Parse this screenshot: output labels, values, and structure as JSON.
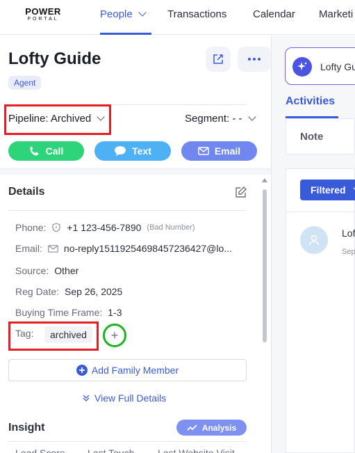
{
  "brand": {
    "line1": "POWER",
    "line2": "PORTAL"
  },
  "nav": {
    "people": "People",
    "transactions": "Transactions",
    "calendar": "Calendar",
    "marketing": "Marketi"
  },
  "contact": {
    "name": "Lofty Guide",
    "badge": "Agent"
  },
  "pipeline": {
    "label": "Pipeline:",
    "value": "Archived"
  },
  "segment": {
    "label": "Segment:",
    "value": "- -"
  },
  "actions": {
    "call": "Call",
    "text": "Text",
    "email": "Email"
  },
  "details": {
    "title": "Details",
    "phone_label": "Phone:",
    "phone_value": "+1 123-456-7890",
    "phone_note": "(Bad Number)",
    "email_label": "Email:",
    "email_value": "no-reply15119254698457236427@lo...",
    "source_label": "Source:",
    "source_value": "Other",
    "regdate_label": "Reg Date:",
    "regdate_value": "Sep 26, 2025",
    "buying_label": "Buying Time Frame:",
    "buying_value": "1-3",
    "tag_label": "Tag:",
    "tag_value": "archived",
    "add_family": "Add Family Member",
    "view_full": "View Full Details"
  },
  "insight": {
    "title": "Insight",
    "analysis": "Analysis",
    "col1": "Lead Score",
    "col2": "Last Touch",
    "col3": "Last Website Visit"
  },
  "right": {
    "assistant_label": "Lofty Gu",
    "activities_tab": "Activities",
    "note_label": "Note",
    "filter_label": "Filtered",
    "feed_name": "Lof",
    "feed_date": "Sep"
  },
  "colors": {
    "accent": "#3a5bd9",
    "call": "#2dd47a",
    "text": "#4db1f4",
    "email": "#6f87ee",
    "highlight_red": "#e31e24",
    "highlight_green": "#1bb51b"
  }
}
